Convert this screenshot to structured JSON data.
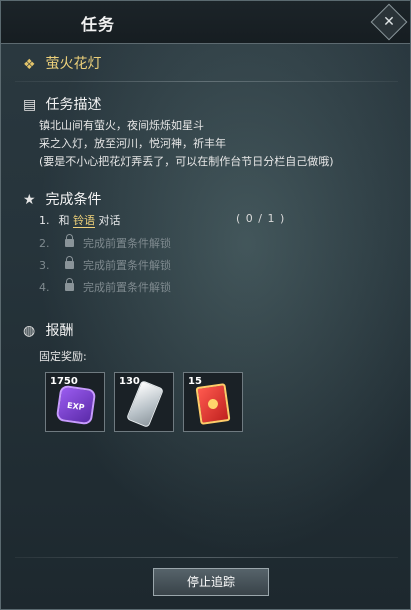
{
  "window": {
    "title": "任务"
  },
  "quest": {
    "name": "萤火花灯"
  },
  "sections": {
    "description": {
      "title": "任务描述",
      "lines": [
        "镇北山间有萤火，夜间烁烁如星斗",
        "采之入灯，放至河川，悦河神，祈丰年",
        "(要是不小心把花灯弄丢了，可以在制作台节日分栏自己做哦)"
      ]
    },
    "conditions": {
      "title": "完成条件",
      "items": [
        {
          "num": "1.",
          "prefix": "和",
          "highlight": "铃语",
          "suffix": "对话",
          "progress": "( 0 / 1 )"
        },
        {
          "num": "2.",
          "text": "完成前置条件解锁"
        },
        {
          "num": "3.",
          "text": "完成前置条件解锁"
        },
        {
          "num": "4.",
          "text": "完成前置条件解锁"
        }
      ]
    },
    "rewards": {
      "title": "报酬",
      "fixed_label": "固定奖励:",
      "items": [
        {
          "count": "1750",
          "icon": "exp-crystal-icon",
          "label": "EXP"
        },
        {
          "count": "130",
          "icon": "crystal-shard-icon"
        },
        {
          "count": "15",
          "icon": "red-envelope-icon"
        }
      ]
    }
  },
  "footer": {
    "stop_tracking_label": "停止追踪"
  },
  "colors": {
    "accent": "#ecd07a",
    "locked": "#7f8a8f"
  }
}
